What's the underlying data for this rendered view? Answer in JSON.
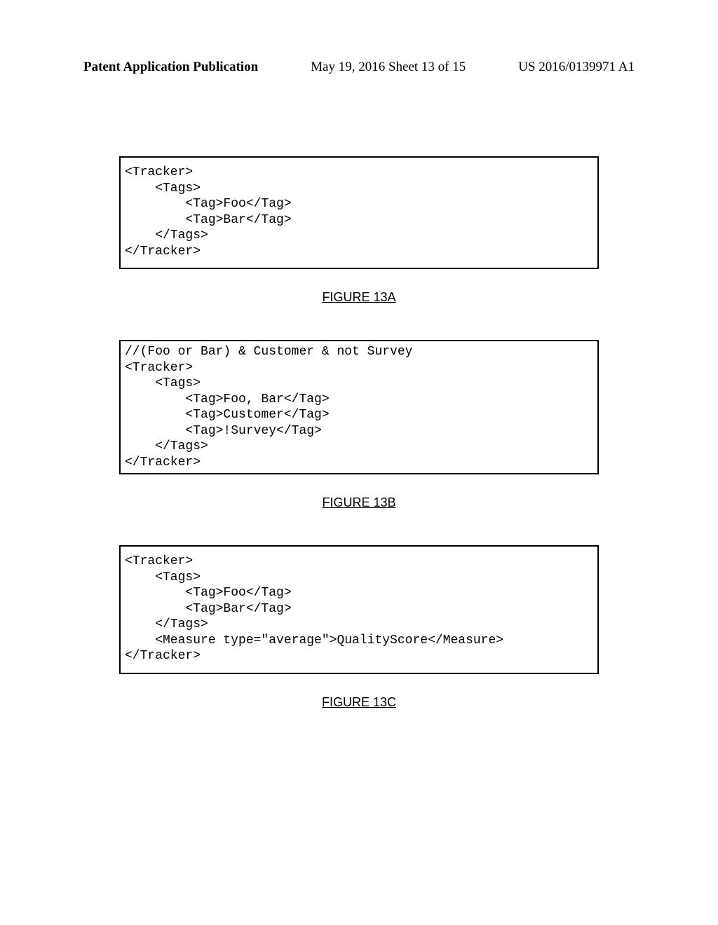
{
  "header": {
    "left": "Patent Application Publication",
    "center": "May 19, 2016  Sheet 13 of 15",
    "right": "US 2016/0139971 A1"
  },
  "figures": {
    "a": {
      "label": "FIGURE 13A",
      "code": "<Tracker>\n    <Tags>\n        <Tag>Foo</Tag>\n        <Tag>Bar</Tag>\n    </Tags>\n</Tracker>"
    },
    "b": {
      "label": "FIGURE 13B",
      "code": "//(Foo or Bar) & Customer & not Survey\n<Tracker>\n    <Tags>\n        <Tag>Foo, Bar</Tag>\n        <Tag>Customer</Tag>\n        <Tag>!Survey</Tag>\n    </Tags>\n</Tracker>"
    },
    "c": {
      "label": "FIGURE 13C",
      "code": "<Tracker>\n    <Tags>\n        <Tag>Foo</Tag>\n        <Tag>Bar</Tag>\n    </Tags>\n    <Measure type=\"average\">QualityScore</Measure>\n</Tracker>"
    }
  }
}
